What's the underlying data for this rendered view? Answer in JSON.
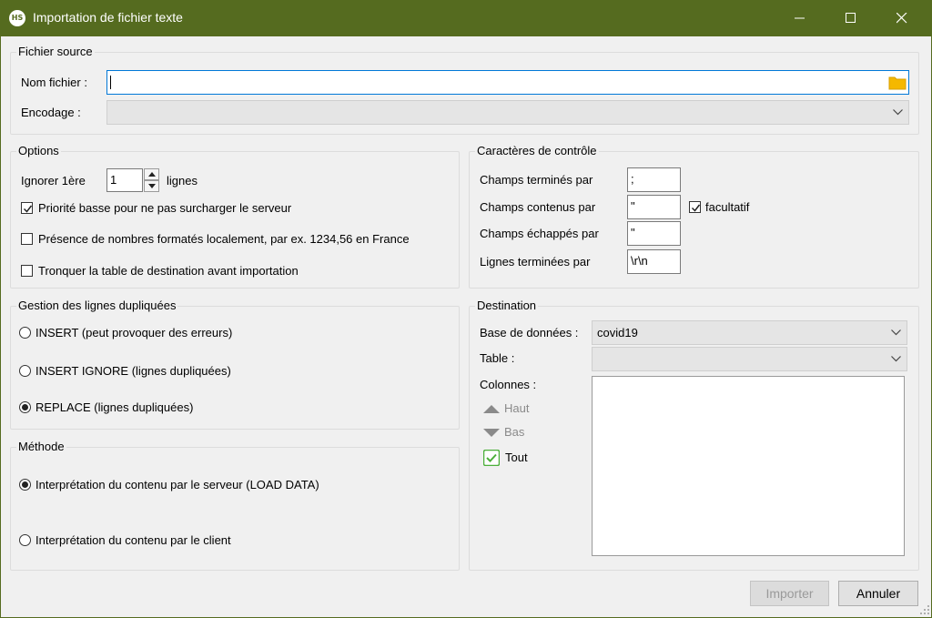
{
  "window": {
    "title": "Importation de fichier texte",
    "app_icon_text": "HS",
    "accent_color": "#556b1f"
  },
  "source": {
    "group_title": "Fichier source",
    "filename_label": "Nom fichier :",
    "filename_value": "",
    "encoding_label": "Encodage :",
    "encoding_value": ""
  },
  "options": {
    "group_title": "Options",
    "ignore_label": "Ignorer 1ère",
    "ignore_value": "1",
    "ignore_suffix": "lignes",
    "low_priority_label": "Priorité basse pour ne pas surcharger le serveur",
    "low_priority_checked": true,
    "local_numbers_label": "Présence de nombres formatés localement, par ex. 1234,56 en France",
    "local_numbers_checked": false,
    "truncate_label": "Tronquer la table de destination avant importation",
    "truncate_checked": false
  },
  "duplicates": {
    "group_title": "Gestion des lignes dupliquées",
    "insert_label": "INSERT (peut provoquer des erreurs)",
    "insert_ignore_label": "INSERT IGNORE (lignes dupliquées)",
    "replace_label": "REPLACE (lignes dupliquées)",
    "selected": "replace"
  },
  "method": {
    "group_title": "Méthode",
    "server_label": "Interprétation du contenu par le serveur (LOAD DATA)",
    "client_label": "Interprétation du contenu par le client",
    "selected": "server"
  },
  "control_chars": {
    "group_title": "Caractères de contrôle",
    "fields_terminated_label": "Champs terminés par",
    "fields_terminated_value": ";",
    "fields_enclosed_label": "Champs contenus par",
    "fields_enclosed_value": "\"",
    "optional_label": "facultatif",
    "optional_checked": true,
    "fields_escaped_label": "Champs échappés par",
    "fields_escaped_value": "\"",
    "lines_terminated_label": "Lignes terminées par",
    "lines_terminated_value": "\\r\\n"
  },
  "destination": {
    "group_title": "Destination",
    "database_label": "Base de données :",
    "database_value": "covid19",
    "table_label": "Table :",
    "table_value": "",
    "columns_label": "Colonnes :",
    "up_label": "Haut",
    "down_label": "Bas",
    "all_label": "Tout"
  },
  "footer": {
    "import_label": "Importer",
    "cancel_label": "Annuler"
  }
}
